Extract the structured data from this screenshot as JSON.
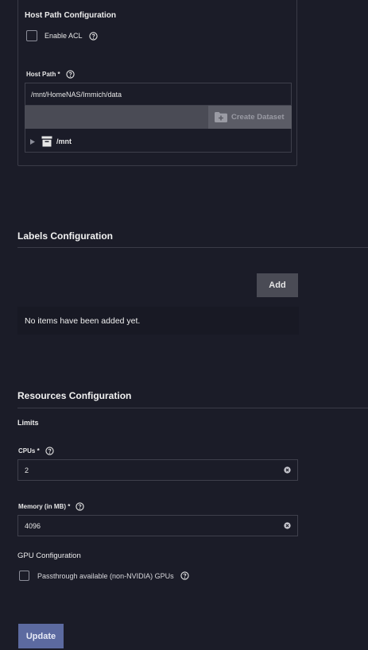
{
  "host_path": {
    "section_title": "Host Path Configuration",
    "enable_acl_label": "Enable ACL",
    "host_path_label": "Host Path *",
    "path_value": "/mnt/HomeNAS/Immich/data",
    "create_dataset_label": "Create Dataset",
    "tree_root": "/mnt"
  },
  "labels": {
    "title": "Labels Configuration",
    "add_label": "Add",
    "empty_message": "No items have been added yet."
  },
  "resources": {
    "title": "Resources Configuration",
    "limits_label": "Limits",
    "cpus_label": "CPUs *",
    "cpus_value": "2",
    "memory_label": "Memory (in MB) *",
    "memory_value": "4096",
    "gpu_title": "GPU Configuration",
    "passthrough_label": "Passthrough available (non-NVIDIA) GPUs"
  },
  "footer": {
    "update_label": "Update"
  },
  "colors": {
    "background": "#1b1c28",
    "primary_button": "#5c6aa0",
    "secondary_button": "#4a4b55"
  }
}
